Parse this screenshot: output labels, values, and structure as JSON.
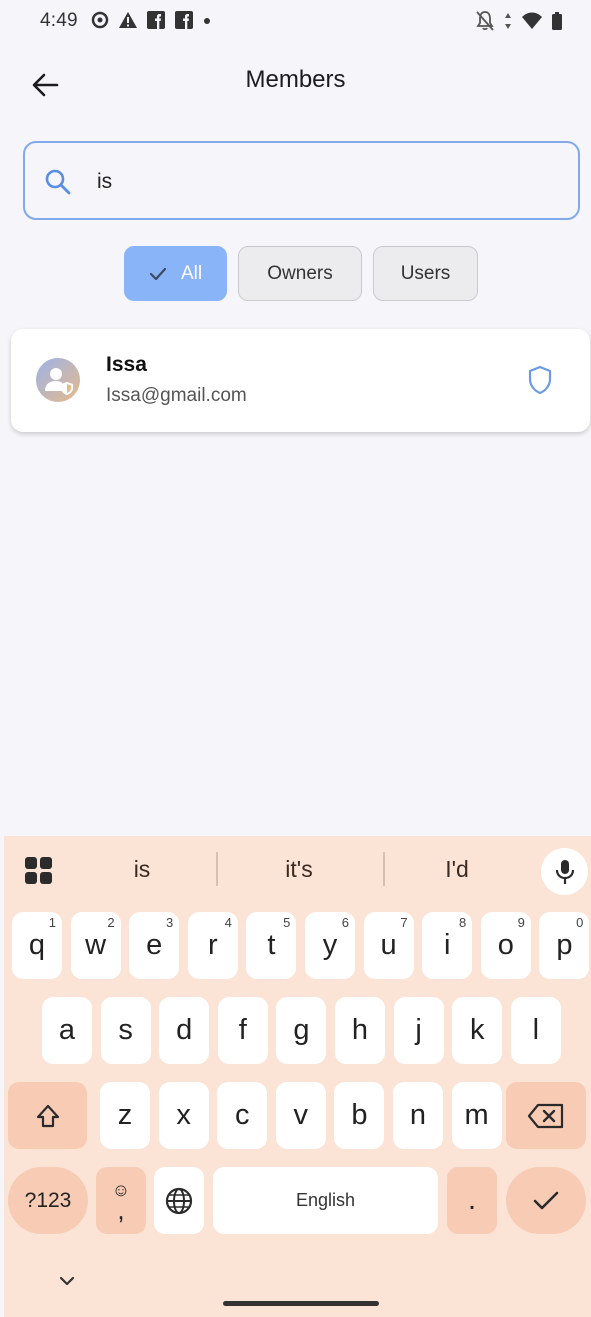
{
  "status_bar": {
    "time": "4:49"
  },
  "header": {
    "title": "Members"
  },
  "search": {
    "value": "is",
    "placeholder": ""
  },
  "filters": [
    {
      "label": "All",
      "selected": true
    },
    {
      "label": "Owners",
      "selected": false
    },
    {
      "label": "Users",
      "selected": false
    }
  ],
  "members": [
    {
      "name": "Issa",
      "email": "Issa@gmail.com",
      "role_icon": "shield-icon"
    }
  ],
  "keyboard": {
    "suggestions": [
      "is",
      "it's",
      "I'd"
    ],
    "row1": [
      {
        "k": "q",
        "n": "1"
      },
      {
        "k": "w",
        "n": "2"
      },
      {
        "k": "e",
        "n": "3"
      },
      {
        "k": "r",
        "n": "4"
      },
      {
        "k": "t",
        "n": "5"
      },
      {
        "k": "y",
        "n": "6"
      },
      {
        "k": "u",
        "n": "7"
      },
      {
        "k": "i",
        "n": "8"
      },
      {
        "k": "o",
        "n": "9"
      },
      {
        "k": "p",
        "n": "0"
      }
    ],
    "row2": [
      "a",
      "s",
      "d",
      "f",
      "g",
      "h",
      "j",
      "k",
      "l"
    ],
    "row3": [
      "z",
      "x",
      "c",
      "v",
      "b",
      "n",
      "m"
    ],
    "symbols_label": "?123",
    "emoji_label": "☺",
    "comma_label": ",",
    "space_label": "English",
    "period_label": "."
  },
  "colors": {
    "accent": "#8ab4f8",
    "keyboard_bg": "#fbe3d6",
    "function_key": "#f8cbb4"
  }
}
